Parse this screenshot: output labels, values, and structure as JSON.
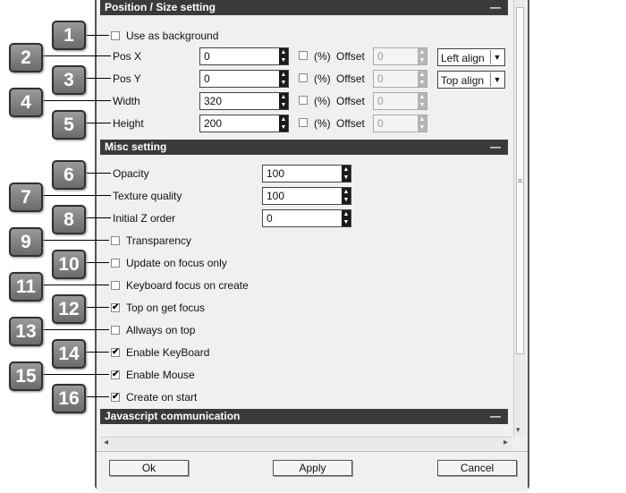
{
  "sections": {
    "position": {
      "title": "Position / Size setting",
      "collapse": "—"
    },
    "misc": {
      "title": "Misc setting",
      "collapse": "—"
    },
    "javascript": {
      "title": "Javascript communication",
      "collapse": "—"
    }
  },
  "position": {
    "use_as_background": {
      "label": "Use as background",
      "checked": false
    },
    "pos_x": {
      "label": "Pos X",
      "value": "0",
      "percent_label": "(%)",
      "offset_label": "Offset",
      "offset_value": "0",
      "align": "Left align"
    },
    "pos_y": {
      "label": "Pos Y",
      "value": "0",
      "percent_label": "(%)",
      "offset_label": "Offset",
      "offset_value": "0",
      "align": "Top align"
    },
    "width": {
      "label": "Width",
      "value": "320",
      "percent_label": "(%)",
      "offset_label": "Offset",
      "offset_value": "0"
    },
    "height": {
      "label": "Height",
      "value": "200",
      "percent_label": "(%)",
      "offset_label": "Offset",
      "offset_value": "0"
    }
  },
  "misc": {
    "opacity": {
      "label": "Opacity",
      "value": "100"
    },
    "texture_quality": {
      "label": "Texture quality",
      "value": "100"
    },
    "initial_z_order": {
      "label": "Initial Z order",
      "value": "0"
    },
    "checkboxes": [
      {
        "label": "Transparency",
        "checked": false
      },
      {
        "label": "Update on focus only",
        "checked": false
      },
      {
        "label": "Keyboard focus on create",
        "checked": false
      },
      {
        "label": "Top on get focus",
        "checked": true
      },
      {
        "label": "Allways on top",
        "checked": false
      },
      {
        "label": "Enable KeyBoard",
        "checked": true
      },
      {
        "label": "Enable Mouse",
        "checked": true
      },
      {
        "label": "Create on start",
        "checked": true
      }
    ]
  },
  "badges": [
    "1",
    "2",
    "3",
    "4",
    "5",
    "6",
    "7",
    "8",
    "9",
    "10",
    "11",
    "12",
    "13",
    "14",
    "15",
    "16"
  ],
  "buttons": {
    "ok": "Ok",
    "apply": "Apply",
    "cancel": "Cancel"
  },
  "glyphs": {
    "check": "✔",
    "up": "▲",
    "down": "▼",
    "dropdown": "▼",
    "scroll_left": "◂",
    "scroll_right": "▸",
    "scroll_down": "▾",
    "grip": "≡"
  }
}
